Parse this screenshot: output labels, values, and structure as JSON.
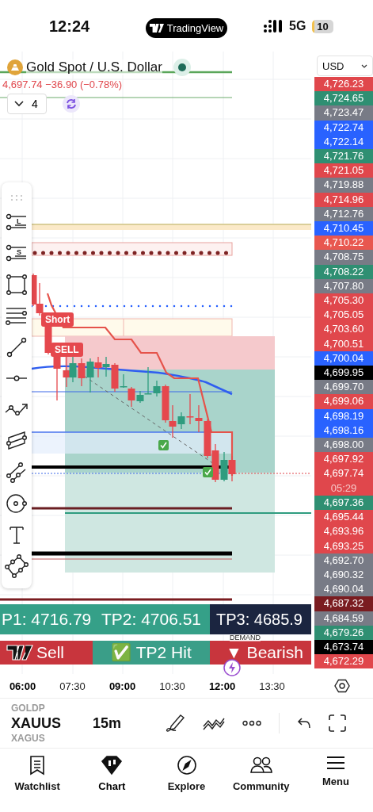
{
  "status_bar": {
    "time": "12:24",
    "app_pill": "TradingView",
    "network": "5G",
    "battery": "10"
  },
  "legend": {
    "symbol": "Gold Spot / U.S. Dollar",
    "market_open": true,
    "quote": "4,697.74 −36.90 (−0.78%)",
    "indicators_count": "4"
  },
  "currency": "USD",
  "drawing_tools": [
    {
      "kind": "drag"
    },
    {
      "kind": "long",
      "badge": "L"
    },
    {
      "kind": "short",
      "badge": "S"
    },
    {
      "kind": "rect"
    },
    {
      "kind": "fib"
    },
    {
      "kind": "line"
    },
    {
      "kind": "hline"
    },
    {
      "kind": "path"
    },
    {
      "kind": "channel"
    },
    {
      "kind": "pitchfork"
    },
    {
      "kind": "circle"
    },
    {
      "kind": "text"
    },
    {
      "kind": "polygon"
    }
  ],
  "chart_labels": [
    {
      "text": "Short"
    },
    {
      "text": "SELL"
    }
  ],
  "price_labels": [
    {
      "text": "4,726.23",
      "color": "#e0474c"
    },
    {
      "text": "4,724.65",
      "color": "#2f8f72"
    },
    {
      "text": "4,723.47",
      "color": "#787b86"
    },
    {
      "text": "4,722.74",
      "color": "#2962ff"
    },
    {
      "text": "4,722.14",
      "color": "#2962ff"
    },
    {
      "text": "4,721.76",
      "color": "#2f8f72"
    },
    {
      "text": "4,721.05",
      "color": "#e0474c"
    },
    {
      "text": "4,719.88",
      "color": "#787b86"
    },
    {
      "text": "4,714.96",
      "color": "#e0474c"
    },
    {
      "text": "4,712.76",
      "color": "#787b86"
    },
    {
      "text": "4,710.45",
      "color": "#2962ff"
    },
    {
      "text": "4,710.22",
      "color": "#e8574f"
    },
    {
      "text": "4,708.75",
      "color": "#787b86"
    },
    {
      "text": "4,708.22",
      "color": "#2f8f72"
    },
    {
      "text": "4,707.80",
      "color": "#787b86"
    },
    {
      "text": "4,705.30",
      "color": "#e0474c"
    },
    {
      "text": "4,705.05",
      "color": "#e0474c"
    },
    {
      "text": "4,703.60",
      "color": "#e0474c"
    },
    {
      "text": "4,700.51",
      "color": "#e0474c"
    },
    {
      "text": "4,700.04",
      "color": "#2962ff"
    },
    {
      "text": "4,699.95",
      "color": "#000000"
    },
    {
      "text": "4,699.70",
      "color": "#787b86"
    },
    {
      "text": "4,699.06",
      "color": "#e0474c"
    },
    {
      "text": "4,698.19",
      "color": "#2962ff"
    },
    {
      "text": "4,698.16",
      "color": "#2962ff"
    },
    {
      "text": "4,698.00",
      "color": "#787b86"
    },
    {
      "text": "4,697.92",
      "color": "#e0474c"
    },
    {
      "text": "4,697.74",
      "color": "#e0474c",
      "countdown": "05:29"
    },
    {
      "text": "4,697.36",
      "color": "#2f8f72"
    },
    {
      "text": "4,695.44",
      "color": "#e0474c"
    },
    {
      "text": "4,693.96",
      "color": "#e0474c"
    },
    {
      "text": "4,693.25",
      "color": "#e0474c"
    },
    {
      "text": "4,692.70",
      "color": "#787b86"
    },
    {
      "text": "4,690.32",
      "color": "#787b86"
    },
    {
      "text": "4,690.04",
      "color": "#787b86"
    },
    {
      "text": "4,687.32",
      "color": "#7a1c20"
    },
    {
      "text": "4,684.59",
      "color": "#787b86"
    },
    {
      "text": "4,679.26",
      "color": "#2f8f72"
    },
    {
      "text": "4,673.74",
      "color": "#000000"
    },
    {
      "text": "4,672.29",
      "color": "#e0474c"
    }
  ],
  "signal_table": {
    "zone_label": "DEMAND",
    "rows": [
      [
        {
          "text": "P1: 4716.79",
          "color": "#35a088"
        },
        {
          "text": "TP2: 4706.51",
          "color": "#35a088"
        },
        {
          "text": "TP3: 4685.9",
          "color": "#1b2540"
        }
      ],
      [
        {
          "text": "Sell",
          "color": "#c8353d"
        },
        {
          "text": "✅ TP2 Hit",
          "color": "#3a9e88"
        },
        {
          "text": "▼ Bearish",
          "color": "#c8353d"
        }
      ]
    ]
  },
  "time_axis": [
    {
      "text": "06:00",
      "bold": true
    },
    {
      "text": "07:30",
      "bold": false
    },
    {
      "text": "09:00",
      "bold": true
    },
    {
      "text": "10:30",
      "bold": false
    },
    {
      "text": "12:00",
      "bold": true
    },
    {
      "text": "13:30",
      "bold": false
    }
  ],
  "symbols": [
    {
      "text": "GOLDP",
      "selected": false
    },
    {
      "text": "XAUUS",
      "selected": true
    },
    {
      "text": "XAGUS",
      "selected": false
    }
  ],
  "interval": "15m",
  "tabs": [
    {
      "label": "Watchlist",
      "kind": "watchlist",
      "selected": false
    },
    {
      "label": "Chart",
      "kind": "chart",
      "selected": true
    },
    {
      "label": "Explore",
      "kind": "explore",
      "selected": false
    },
    {
      "label": "Community",
      "kind": "community",
      "selected": false
    },
    {
      "label": "Menu",
      "kind": "menu",
      "selected": false
    }
  ]
}
